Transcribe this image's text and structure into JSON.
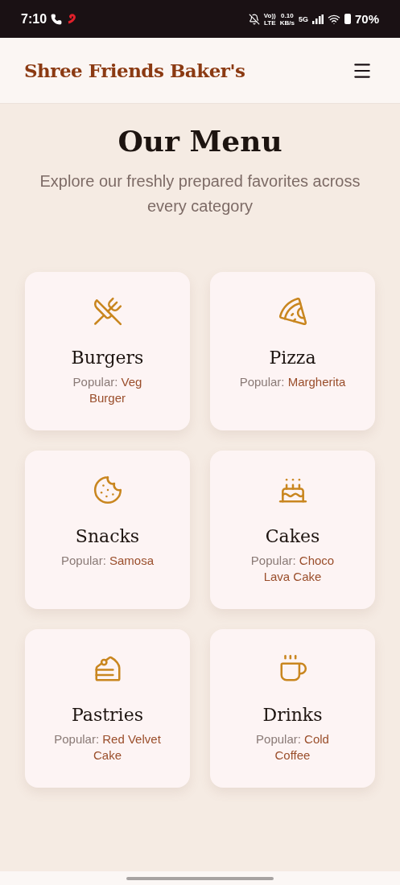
{
  "status_bar": {
    "time": "7:10",
    "network": [
      "Vo))",
      "LTE"
    ],
    "speed": [
      "0.10",
      "KB/s"
    ],
    "signal_label": "5G",
    "battery": "70%"
  },
  "header": {
    "brand": "Shree Friends Baker's"
  },
  "hero": {
    "title": "Our Menu",
    "subtitle": "Explore our freshly prepared favorites across every category"
  },
  "categories": [
    {
      "name": "Burgers",
      "popular_label": "Popular:",
      "popular_item": "Veg Burger"
    },
    {
      "name": "Pizza",
      "popular_label": "Popular:",
      "popular_item": "Margherita"
    },
    {
      "name": "Snacks",
      "popular_label": "Popular:",
      "popular_item": "Samosa"
    },
    {
      "name": "Cakes",
      "popular_label": "Popular:",
      "popular_item": "Choco Lava Cake"
    },
    {
      "name": "Pastries",
      "popular_label": "Popular:",
      "popular_item": "Red Velvet Cake"
    },
    {
      "name": "Drinks",
      "popular_label": "Popular:",
      "popular_item": "Cold Coffee"
    }
  ]
}
